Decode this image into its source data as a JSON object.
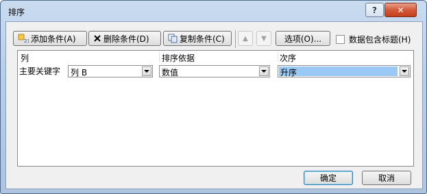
{
  "window": {
    "title": "排序",
    "help_label": "?",
    "close_label": "✕"
  },
  "toolbar": {
    "add_label": "添加条件(A)",
    "delete_label": "删除条件(D)",
    "copy_label": "复制条件(C)",
    "options_label": "选项(O)...",
    "header_checkbox_label": "数据包含标题(H)",
    "header_checkbox_checked": false
  },
  "grid": {
    "headers": {
      "column": "列",
      "sort_on": "排序依据",
      "order": "次序"
    },
    "rows": [
      {
        "label": "主要关键字",
        "column": "列 B",
        "sort_on": "数值",
        "order": "升序"
      }
    ]
  },
  "footer": {
    "ok_label": "确定",
    "cancel_label": "取消"
  },
  "colors": {
    "accent_selection": "#99c9f4",
    "title_gradient": "#c9dbef",
    "close_red": "#c63f1b"
  }
}
